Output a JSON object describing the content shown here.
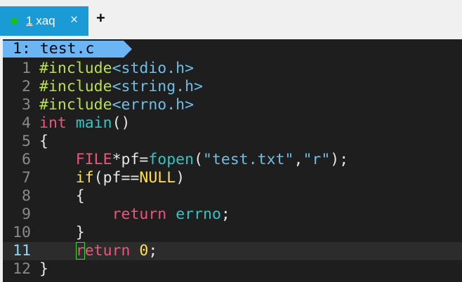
{
  "tabbar": {
    "tab": {
      "number": "1",
      "name": "xaq",
      "status_color": "#17c217",
      "close_glyph": "×"
    },
    "new_tab_glyph": "+"
  },
  "editor": {
    "buffer_label": "1: test.c",
    "current_line": 11,
    "lines": [
      {
        "num": "1",
        "tokens": [
          {
            "t": "#include",
            "c": "inc"
          },
          {
            "t": "<stdio.h>",
            "c": "hdr"
          }
        ]
      },
      {
        "num": "2",
        "tokens": [
          {
            "t": "#include",
            "c": "inc"
          },
          {
            "t": "<string.h>",
            "c": "hdr"
          }
        ]
      },
      {
        "num": "3",
        "tokens": [
          {
            "t": "#include",
            "c": "inc"
          },
          {
            "t": "<errno.h>",
            "c": "hdr"
          }
        ]
      },
      {
        "num": "4",
        "tokens": [
          {
            "t": "int",
            "c": "kw"
          },
          {
            "t": " ",
            "c": "pl"
          },
          {
            "t": "main",
            "c": "fn"
          },
          {
            "t": "()",
            "c": "pl"
          }
        ]
      },
      {
        "num": "5",
        "tokens": [
          {
            "t": "{",
            "c": "pl"
          }
        ]
      },
      {
        "num": "6",
        "tokens": [
          {
            "t": "    ",
            "c": "pl"
          },
          {
            "t": "FILE",
            "c": "kw"
          },
          {
            "t": "*pf=",
            "c": "pl"
          },
          {
            "t": "fopen",
            "c": "fn"
          },
          {
            "t": "(",
            "c": "pl"
          },
          {
            "t": "\"test.txt\"",
            "c": "str"
          },
          {
            "t": ",",
            "c": "pl"
          },
          {
            "t": "\"r\"",
            "c": "str"
          },
          {
            "t": ");",
            "c": "pl"
          }
        ]
      },
      {
        "num": "7",
        "tokens": [
          {
            "t": "    ",
            "c": "pl"
          },
          {
            "t": "if",
            "c": "kw2"
          },
          {
            "t": "(pf==",
            "c": "pl"
          },
          {
            "t": "NULL",
            "c": "mac"
          },
          {
            "t": ")",
            "c": "pl"
          }
        ]
      },
      {
        "num": "8",
        "tokens": [
          {
            "t": "    {",
            "c": "pl"
          }
        ]
      },
      {
        "num": "9",
        "tokens": [
          {
            "t": "        ",
            "c": "pl"
          },
          {
            "t": "return",
            "c": "kw"
          },
          {
            "t": " ",
            "c": "pl"
          },
          {
            "t": "errno",
            "c": "fn"
          },
          {
            "t": ";",
            "c": "pl"
          }
        ]
      },
      {
        "num": "10",
        "tokens": [
          {
            "t": "    }",
            "c": "pl"
          }
        ]
      },
      {
        "num": "11",
        "tokens": [
          {
            "t": "    ",
            "c": "pl"
          },
          {
            "t": "r",
            "c": "kw cursor"
          },
          {
            "t": "eturn",
            "c": "kw"
          },
          {
            "t": " ",
            "c": "pl"
          },
          {
            "t": "0",
            "c": "mac"
          },
          {
            "t": ";",
            "c": "pl"
          }
        ]
      },
      {
        "num": "12",
        "tokens": [
          {
            "t": "}",
            "c": "pl"
          }
        ]
      }
    ]
  }
}
